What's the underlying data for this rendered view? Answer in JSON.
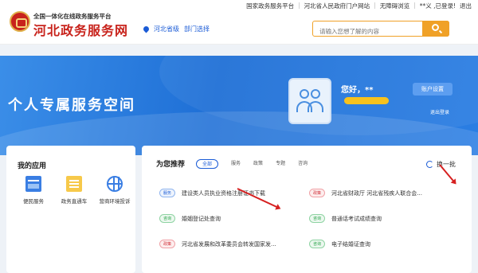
{
  "top_links": [
    "国家政务服务平台",
    "河北省人民政府门户网站",
    "无障碍浏览",
    "**义 ,已登录!",
    "退出"
  ],
  "brand": {
    "subtitle": "全国一体化在线政务服务平台",
    "title": "河北政务服务网"
  },
  "location": {
    "province": "河北省级",
    "dept_select": "部门选择"
  },
  "search": {
    "placeholder": "请输入您想了解的内容"
  },
  "banner": {
    "title": "个人专属服务空间"
  },
  "user": {
    "greeting": "您好，**",
    "settings_label": "账户设置",
    "logout_label": "退出登录"
  },
  "apps_card": {
    "title": "我的应用",
    "apps": [
      {
        "label": "便民服务",
        "icon": "window-icon"
      },
      {
        "label": "政务直通车",
        "icon": "document-icon"
      },
      {
        "label": "营商环境投诉",
        "icon": "globe-icon"
      }
    ]
  },
  "recommend": {
    "title": "为您推荐",
    "chips": [
      "全部",
      "服务",
      "政策",
      "专题",
      "咨询"
    ],
    "refresh_label": "换一批",
    "items": [
      {
        "tag": "服务",
        "tag_color": "blue",
        "text": "建设类人员执业资格注册证书下载"
      },
      {
        "tag": "政策",
        "tag_color": "red",
        "text": "河北省财政厅 河北省残疾人联合会..."
      },
      {
        "tag": "咨询",
        "tag_color": "green",
        "text": "婚姻登记处查询"
      },
      {
        "tag": "咨询",
        "tag_color": "green",
        "text": "普通话考试成绩查询"
      },
      {
        "tag": "政策",
        "tag_color": "red",
        "text": "河北省发展和改革委员会转发国家发..."
      },
      {
        "tag": "咨询",
        "tag_color": "green",
        "text": "电子结婚证查询"
      }
    ]
  },
  "colors": {
    "brand_red": "#c8231c",
    "accent_blue": "#1a5bd6",
    "search_orange": "#f0a127",
    "annotation_red": "#d62020"
  }
}
